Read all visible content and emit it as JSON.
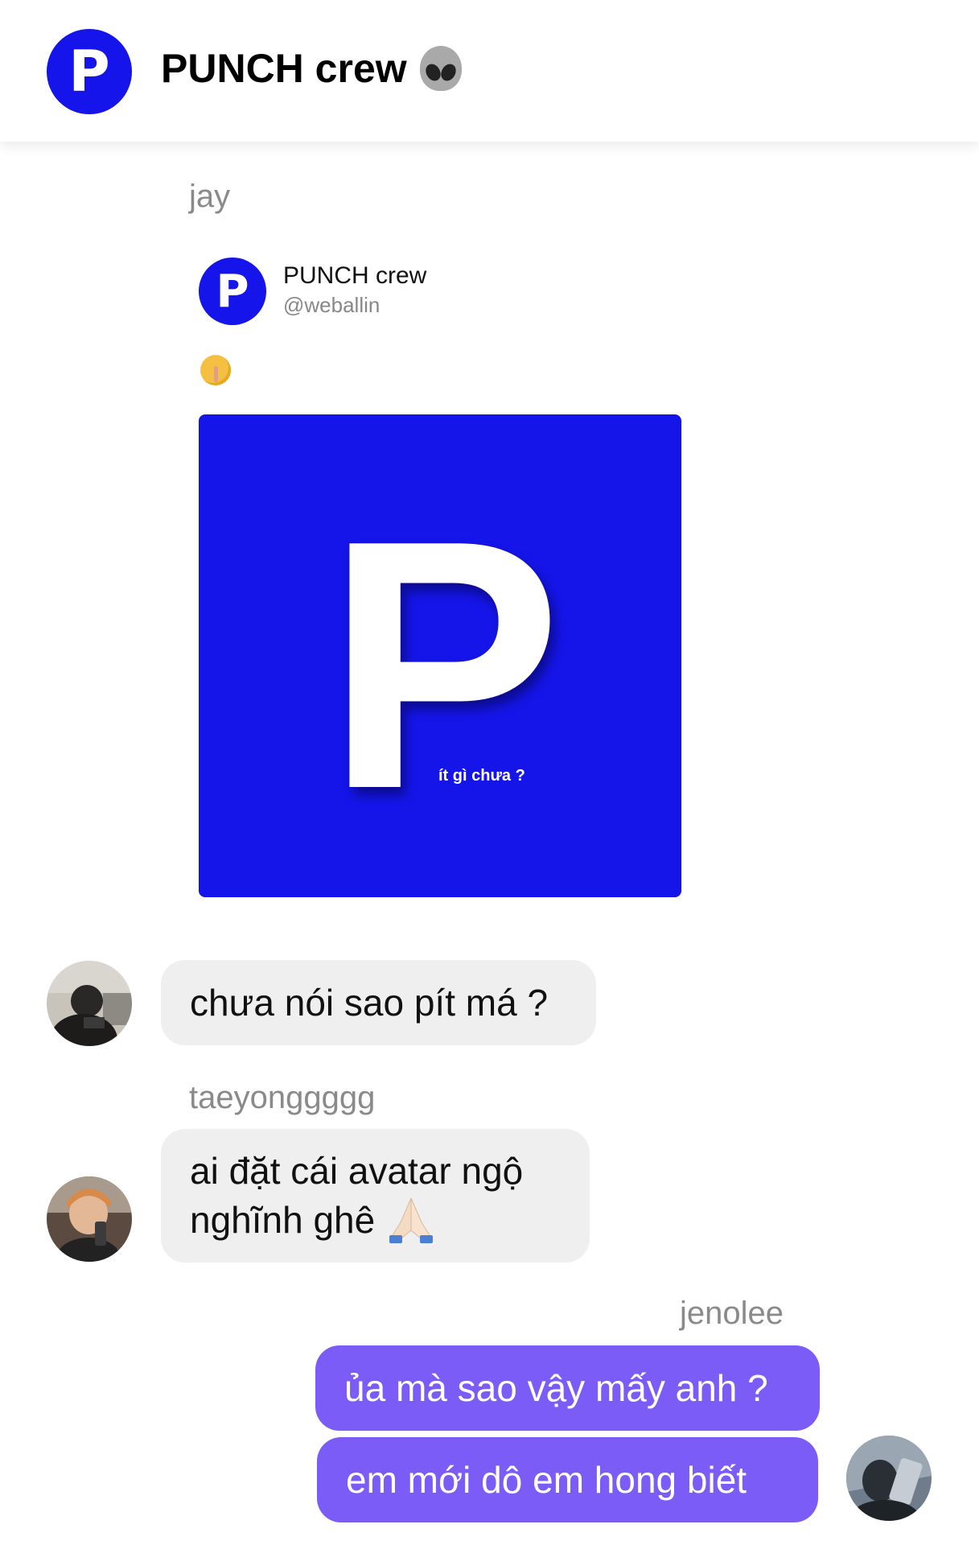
{
  "header": {
    "logo_letter": "P",
    "title": "PUNCH crew"
  },
  "messages": {
    "m1": {
      "sender": "jay",
      "card": {
        "avatar_letter": "P",
        "name": "PUNCH crew",
        "handle": "@weballin",
        "image_letter": "P",
        "image_caption": "ít gì chưa ?"
      }
    },
    "m2": {
      "text": "chưa nói sao pít má ?"
    },
    "m3": {
      "sender": "taeyonggggg",
      "text_line1": "ai đặt cái avatar ngộ",
      "text_line2": "nghĩnh ghê"
    },
    "m4": {
      "sender": "jenolee",
      "text": "ủa mà sao vậy mấy anh ?"
    },
    "m5": {
      "text": "em mới dô em hong biết"
    }
  },
  "colors": {
    "brand_blue": "#1414eb",
    "outgoing_bubble": "#7c5cf6",
    "incoming_bubble": "#efefef"
  }
}
